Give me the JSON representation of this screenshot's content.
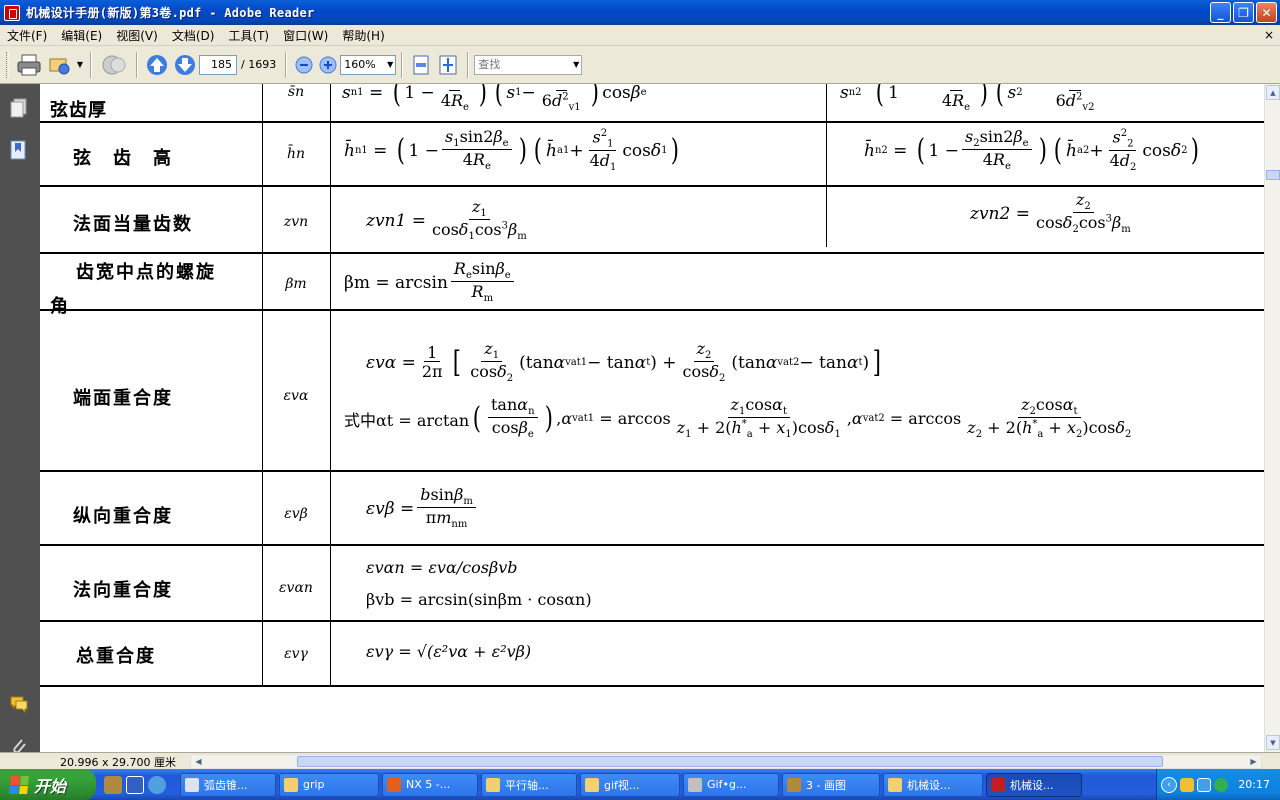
{
  "window": {
    "title": "机械设计手册(新版)第3卷.pdf - Adobe Reader",
    "minimize": "_",
    "maximize": "❐",
    "close": "✕"
  },
  "menu": {
    "items": [
      {
        "label": "文件(F)"
      },
      {
        "label": "编辑(E)"
      },
      {
        "label": "视图(V)"
      },
      {
        "label": "文档(D)"
      },
      {
        "label": "工具(T)"
      },
      {
        "label": "窗口(W)"
      },
      {
        "label": "帮助(H)"
      }
    ],
    "doc_close": "×"
  },
  "toolbar": {
    "page_current": "185",
    "page_total": "/ 1693",
    "zoom": "160%",
    "search_placeholder": "查找"
  },
  "table": {
    "rows": [
      {
        "name": "弦齿厚",
        "symbol": "s̄n"
      },
      {
        "name": "弦　齿　高",
        "symbol": "h̄n"
      },
      {
        "name": "法面当量齿数",
        "symbol": "zvn"
      },
      {
        "name_line1": "齿宽中点的螺旋",
        "name_line2": "角",
        "symbol": "βm"
      },
      {
        "name": "端面重合度",
        "symbol": "εvα"
      },
      {
        "name": "纵向重合度",
        "symbol": "εvβ"
      },
      {
        "name": "法向重合度",
        "symbol": "εvαn"
      },
      {
        "name": "总重合度",
        "symbol": "εvγ"
      }
    ],
    "formulas": {
      "zvn1_lhs": "zvn1 =",
      "zvn2_lhs": "zvn2 =",
      "beta_lhs": "βm = arcsin",
      "eva_lhs": "εvα =",
      "eva_where": "式中αt = arctan",
      "evb_lhs": "εvβ =",
      "evan_line1": "εvαn = εvα/cosβvb",
      "evan_line2": "βvb = arcsin(sinβm · cosαn)",
      "evg": "εvγ = √(ε²vα + ε²vβ)"
    }
  },
  "status": {
    "page_size": "20.996 x 29.700 厘米"
  },
  "taskbar": {
    "start_label": "开始",
    "tasks": [
      {
        "label": "弧齿锥..."
      },
      {
        "label": "grip"
      },
      {
        "label": "NX 5 -..."
      },
      {
        "label": "平行轴..."
      },
      {
        "label": "gif视..."
      },
      {
        "label": "Gif•g..."
      },
      {
        "label": "3 - 画图"
      },
      {
        "label": "机械设..."
      },
      {
        "label": "机械设..."
      }
    ],
    "clock": "20:17"
  },
  "colors": {
    "titlebar": "#0349c9",
    "taskbar": "#245edc",
    "start": "#35a33a",
    "navpane": "#505050"
  }
}
